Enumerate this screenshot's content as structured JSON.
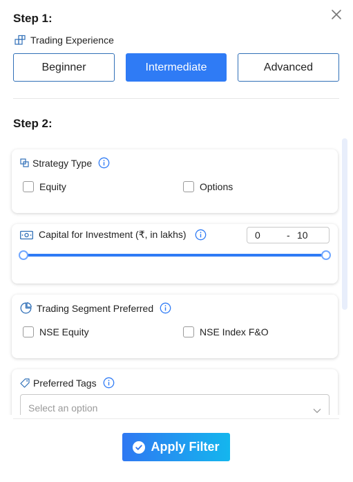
{
  "step1": {
    "title": "Step 1:",
    "experience_label": "Trading Experience",
    "levels": [
      {
        "label": "Beginner",
        "selected": false
      },
      {
        "label": "Intermediate",
        "selected": true
      },
      {
        "label": "Advanced",
        "selected": false
      }
    ]
  },
  "step2": {
    "title": "Step 2:",
    "strategy": {
      "label": "Strategy Type",
      "options": [
        {
          "label": "Equity",
          "checked": false
        },
        {
          "label": "Options",
          "checked": false
        }
      ]
    },
    "capital": {
      "label": "Capital for Investment (₹, in lakhs)",
      "min": "0",
      "separator": "-",
      "max": "10"
    },
    "segment": {
      "label": "Trading Segment Preferred",
      "options": [
        {
          "label": "NSE Equity",
          "checked": false
        },
        {
          "label": "NSE Index F&O",
          "checked": false
        }
      ]
    },
    "tags": {
      "label": "Preferred Tags",
      "placeholder": "Select an option"
    }
  },
  "footer": {
    "apply_label": "Apply Filter"
  },
  "icons": {
    "close": "close-icon",
    "experience": "blocks-icon",
    "strategy": "overlap-squares-icon",
    "capital": "money-icon",
    "segment": "pie-chart-icon",
    "tags": "tag-icon",
    "info": "info-icon",
    "apply": "check-circle-icon",
    "select": "chevron-down-icon"
  },
  "colors": {
    "accent": "#2f7bf5",
    "border": "#2f6fb7",
    "gradient_end": "#14b6ee"
  }
}
